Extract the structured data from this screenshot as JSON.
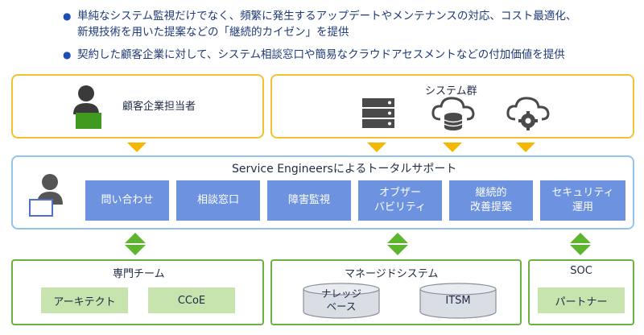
{
  "bullets": [
    "単純なシステム監視だけでなく、頻繁に発生するアップデートやメンテナンスの対応、コスト最適化、\n新規技術を用いた提案などの「継続的カイゼン」を提供",
    "契約した顧客企業に対して、システム相談窓口や簡易なクラウドアセスメントなどの付加価値を提供"
  ],
  "bullet_glyph": "●",
  "customer": {
    "label": "顧客企業担当者"
  },
  "systems": {
    "title": "システム群"
  },
  "support": {
    "title": "Service Engineersによるトータルサポート",
    "tiles": [
      "問い合わせ",
      "相談窓口",
      "障害監視",
      "オブザー\nバビリティ",
      "継続的\n改善提案",
      "セキュリティ\n運用"
    ]
  },
  "team": {
    "title": "専門チーム",
    "items": [
      "アーキテクト",
      "CCoE"
    ]
  },
  "managed": {
    "title": "マネージドシステム",
    "items": [
      "ナレッジ\nベース",
      "ITSM"
    ]
  },
  "soc": {
    "title": "SOC",
    "items": [
      "パートナー"
    ]
  },
  "colors": {
    "orange_border": "#f2c230",
    "blue_border": "#93c4ee",
    "green_border": "#6cb240",
    "tile_blue": "#6d93e0",
    "green_fill": "#c7e3ae",
    "arrow_orange": "#f5b800",
    "arrow_green": "#5db52f"
  }
}
